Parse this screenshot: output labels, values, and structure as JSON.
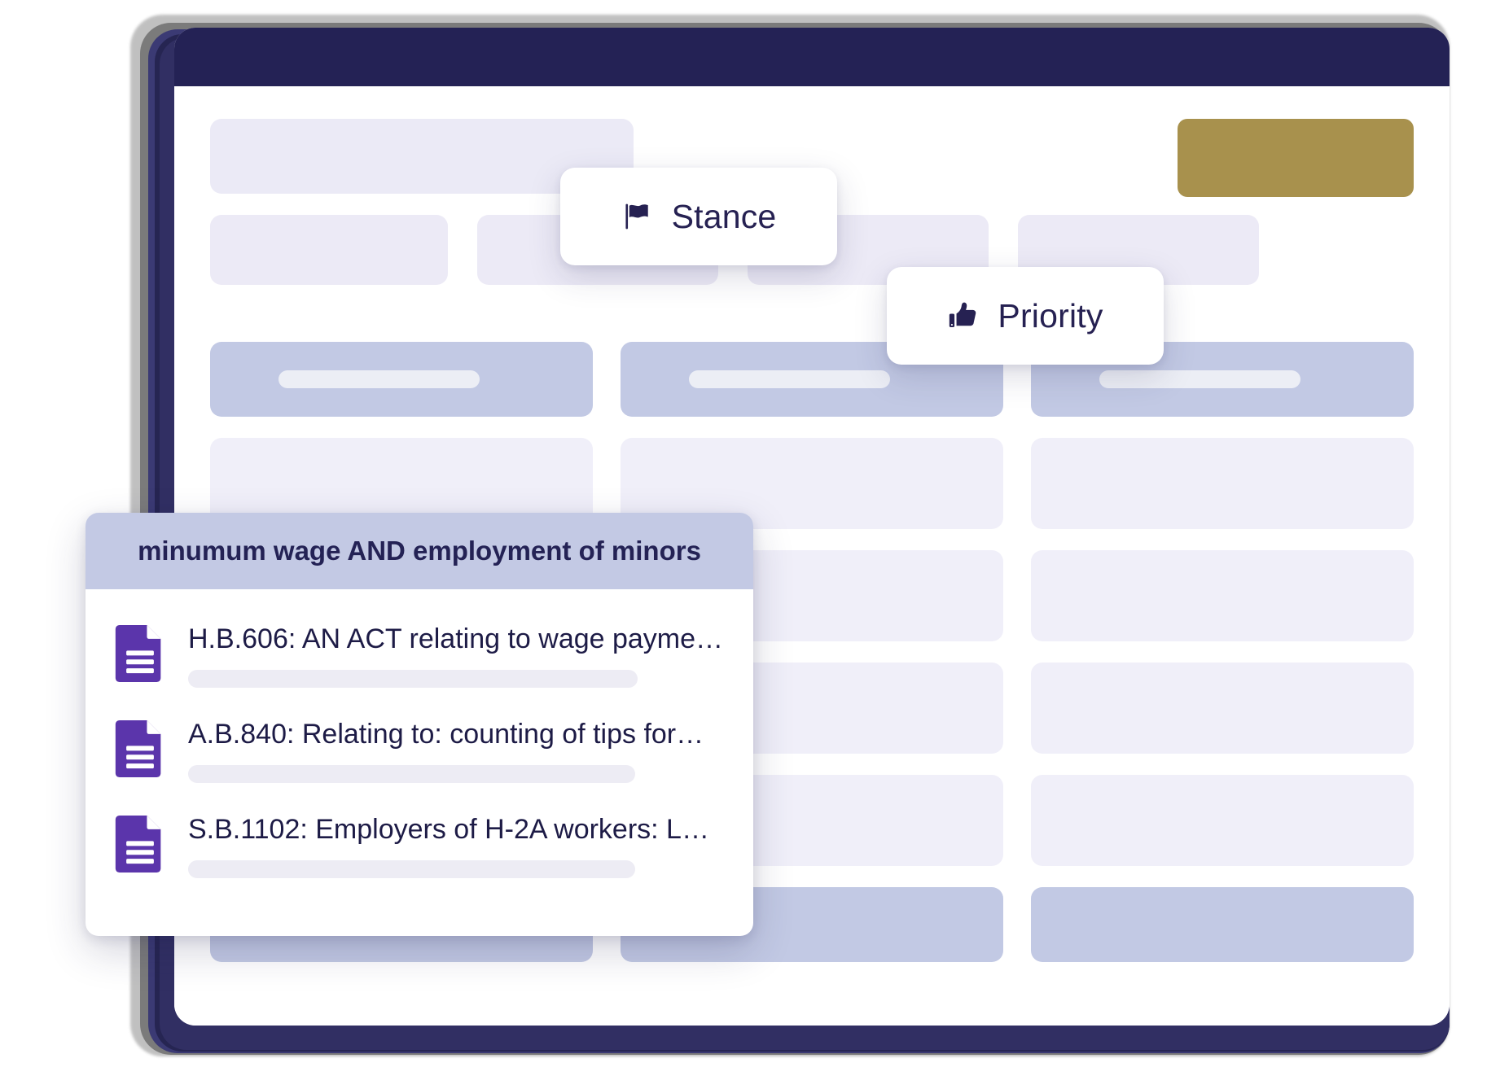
{
  "window": {
    "titlebar_color": "#242255",
    "background": "#ffffff"
  },
  "toolbar": {
    "primary_button_label": "",
    "primary_button_color": "#a8914d"
  },
  "tags": [
    {
      "id": "stance",
      "label": "Stance",
      "icon": "flag-icon",
      "color": "#262152"
    },
    {
      "id": "priority",
      "label": "Priority",
      "icon": "thumbs-up-icon",
      "color": "#262152"
    }
  ],
  "search_results": {
    "query_header": "minumum wage AND employment of minors",
    "header_color": "#c3c9e4",
    "items": [
      {
        "icon": "document-icon",
        "title": "H.B.606: AN ACT relating to wage payme…"
      },
      {
        "icon": "document-icon",
        "title": "A.B.840: Relating to: counting of tips for…"
      },
      {
        "icon": "document-icon",
        "title": "S.B.1102: Employers of H-2A workers: L…"
      }
    ],
    "icon_color": "#5b35ab"
  },
  "skeleton": {
    "title_block": "",
    "chips": [
      "",
      "",
      "",
      ""
    ],
    "columns": [
      {
        "header": "",
        "cells": [
          "",
          "",
          "",
          ""
        ],
        "footer": ""
      },
      {
        "header": "",
        "cells": [
          "",
          "",
          "",
          ""
        ],
        "footer": ""
      },
      {
        "header": "",
        "cells": [
          "",
          "",
          "",
          ""
        ],
        "footer": ""
      }
    ],
    "block_color": "#ebeaf6",
    "cell_color": "#f0eff9",
    "header_color": "#c2c9e4"
  },
  "theme": {
    "navy": "#242255",
    "gold": "#a8914d",
    "purple": "#5b35ab",
    "lavender": "#c3c9e4"
  }
}
